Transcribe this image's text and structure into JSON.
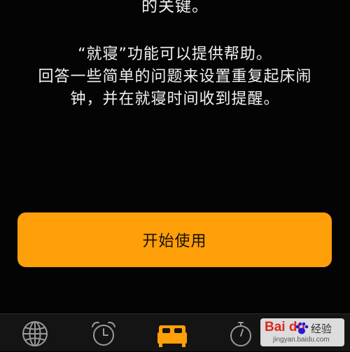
{
  "intro": {
    "tail": "的关键。"
  },
  "body": {
    "lines": [
      "“就寝”功能可以提供帮助。",
      "回答一些简单的问题来设置重复起床闹",
      "钟，并在就寝时间收到提醒。"
    ]
  },
  "cta": {
    "label": "开始使用"
  },
  "tabs": [
    {
      "id": "world-clock",
      "icon": "globe-icon",
      "active": false
    },
    {
      "id": "alarm",
      "icon": "alarm-clock-icon",
      "active": false
    },
    {
      "id": "bedtime",
      "icon": "bed-icon",
      "active": true
    },
    {
      "id": "stopwatch",
      "icon": "stopwatch-icon",
      "active": false
    }
  ],
  "watermark": {
    "brand": "Bai du",
    "cn": "经验",
    "url": "jingyan.baidu.com"
  },
  "colors": {
    "accent": "#ff9f0a",
    "background": "#040404",
    "inactive_icon": "#9a9a9a"
  }
}
